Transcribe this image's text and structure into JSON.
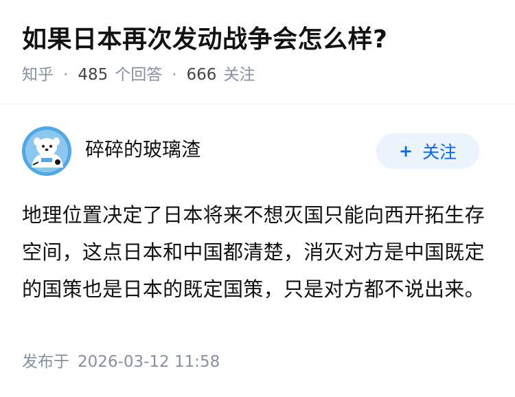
{
  "question": {
    "title": "如果日本再次发动战争会怎么样?",
    "source": "知乎",
    "answer_count": "485",
    "answer_label": "个回答",
    "follower_count": "666",
    "follower_label": "关注",
    "separator": "·"
  },
  "author": {
    "name": "碎碎的玻璃渣",
    "avatar_icon": "avatar-character-icon",
    "follow_button": {
      "plus": "+",
      "label": "关注"
    }
  },
  "answer": {
    "text": "地理位置决定了日本将来不想灭国只能向西开拓生存空间，这点日本和中国都清楚，消灭对方是中国既定的国策也是日本的既定国策，只是对方都不说出来。",
    "published_label": "发布于",
    "published_date": "2026-03-12 11:58"
  },
  "colors": {
    "accent": "#0066ff",
    "follow_bg": "#ebf3fd",
    "meta_text": "#8590a6",
    "primary_text": "#121212",
    "avatar_bg": "#4fa9e6"
  }
}
